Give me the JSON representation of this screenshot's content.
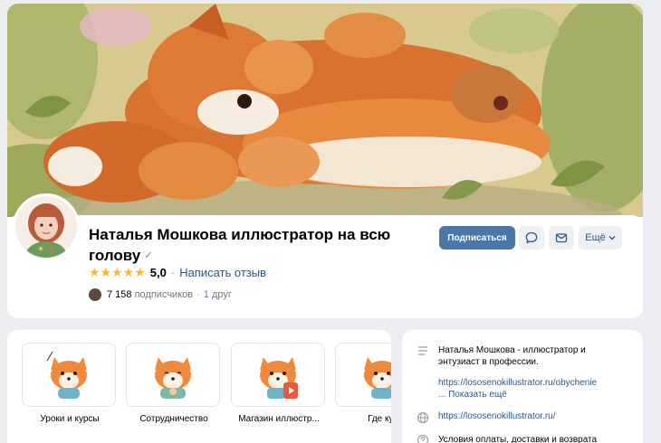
{
  "profile": {
    "name": "Наталья Мошкова иллюстратор на всю голову",
    "verified_mark": "✓",
    "rating": {
      "stars_display": "★★★★★",
      "value": "5,0",
      "separator": "·",
      "review_link": "Написать отзыв"
    },
    "subscribers": {
      "count": "7 158",
      "label": "подписчиков",
      "separator": "·",
      "friends": "1 друг"
    },
    "actions": {
      "subscribe": "Подписаться",
      "more": "Ещё",
      "message_icon": "chat-bubble-icon",
      "mail_icon": "envelope-icon"
    }
  },
  "products": [
    {
      "label": "Уроки и курсы",
      "icon": "fox-teacher-icon"
    },
    {
      "label": "Сотрудничество",
      "icon": "fox-handshake-icon"
    },
    {
      "label": "Магазин иллюстр...",
      "icon": "fox-shop-icon"
    },
    {
      "label": "Где куп",
      "icon": "fox-cart-icon"
    }
  ],
  "info": {
    "description": "Наталья Мошкова - иллюстратор и энтузиаст в профессии.",
    "link_primary": "https://lososenokillustrator.ru/obychenie",
    "show_more": "... Показать ещё",
    "website": "https://lososenokillustrator.ru/",
    "payment": "Условия оплаты, доставки и возврата"
  },
  "colors": {
    "accent": "#4a76a8",
    "link": "#2a5885",
    "star": "#f5b83b",
    "background": "#ebedf0"
  }
}
